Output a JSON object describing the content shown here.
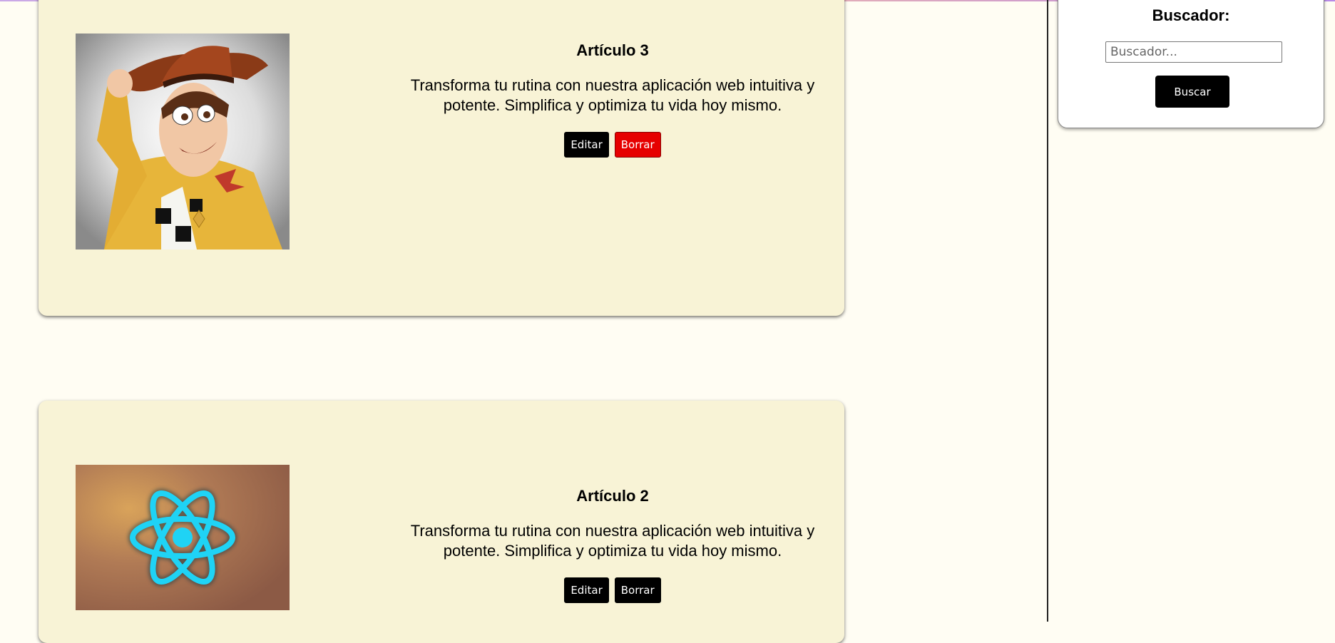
{
  "articles": [
    {
      "title": "Artículo 3",
      "text": "Transforma tu rutina con nuestra aplicación web intuitiva y potente. Simplifica y optimiza tu vida hoy mismo.",
      "edit_label": "Editar",
      "delete_label": "Borrar",
      "image": "cowboy-toy-character-image"
    },
    {
      "title": "Artículo 2",
      "text": "Transforma tu rutina con nuestra aplicación web intuitiva y potente. Simplifica y optimiza tu vida hoy mismo.",
      "edit_label": "Editar",
      "delete_label": "Borrar",
      "image": "react-logo-image"
    }
  ],
  "sidebar": {
    "search_title": "Buscador:",
    "search_placeholder": "Buscador...",
    "search_button": "Buscar"
  },
  "colors": {
    "page_background": "#fffdf3",
    "card_background": "#f8f3d6",
    "button": "#000000",
    "danger_button": "#e60000",
    "react_logo": "#1fd3f5"
  }
}
